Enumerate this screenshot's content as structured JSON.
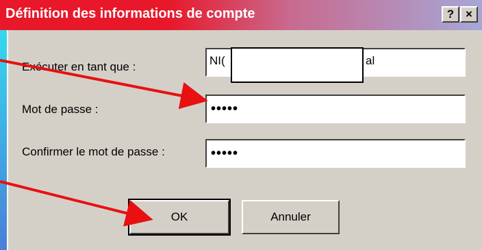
{
  "dialog": {
    "title": "Définition des informations de compte",
    "help_button": "?",
    "close_button": "×"
  },
  "form": {
    "run_as_label": "Exécuter en tant que :",
    "run_as_value_prefix": "NI(",
    "run_as_value_suffix": "al",
    "password_label": "Mot de passe :",
    "password_value": "•••••",
    "confirm_label": "Confirmer le mot de passe :",
    "confirm_value": "•••••"
  },
  "buttons": {
    "ok_label": "OK",
    "cancel_label": "Annuler"
  },
  "annotation": {
    "arrow_color": "#e81010"
  }
}
